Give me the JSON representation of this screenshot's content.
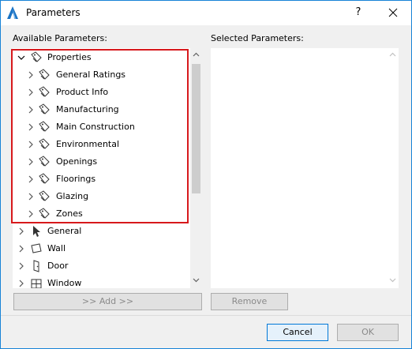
{
  "window": {
    "title": "Parameters",
    "help_label": "?",
    "accent_color": "#1883d7"
  },
  "left_panel": {
    "label": "Available Parameters:",
    "tree": [
      {
        "label": "Properties",
        "icon": "tag-icon",
        "expanded": true,
        "level": 0
      },
      {
        "label": "General Ratings",
        "icon": "tag-icon",
        "level": 1
      },
      {
        "label": "Product Info",
        "icon": "tag-icon",
        "level": 1
      },
      {
        "label": "Manufacturing",
        "icon": "tag-icon",
        "level": 1
      },
      {
        "label": "Main Construction",
        "icon": "tag-icon",
        "level": 1
      },
      {
        "label": "Environmental",
        "icon": "tag-icon",
        "level": 1
      },
      {
        "label": "Openings",
        "icon": "tag-icon",
        "level": 1
      },
      {
        "label": "Floorings",
        "icon": "tag-icon",
        "level": 1
      },
      {
        "label": "Glazing",
        "icon": "tag-icon",
        "level": 1
      },
      {
        "label": "Zones",
        "icon": "tag-icon",
        "level": 1
      },
      {
        "label": "General",
        "icon": "pointer-icon",
        "level": 0
      },
      {
        "label": "Wall",
        "icon": "wall-icon",
        "level": 0
      },
      {
        "label": "Door",
        "icon": "door-icon",
        "level": 0
      },
      {
        "label": "Window",
        "icon": "window-icon",
        "level": 0
      }
    ]
  },
  "right_panel": {
    "label": "Selected Parameters:"
  },
  "buttons": {
    "add": ">> Add >>",
    "remove": "Remove",
    "cancel": "Cancel",
    "ok": "OK"
  },
  "highlight_color": "#d7191c"
}
